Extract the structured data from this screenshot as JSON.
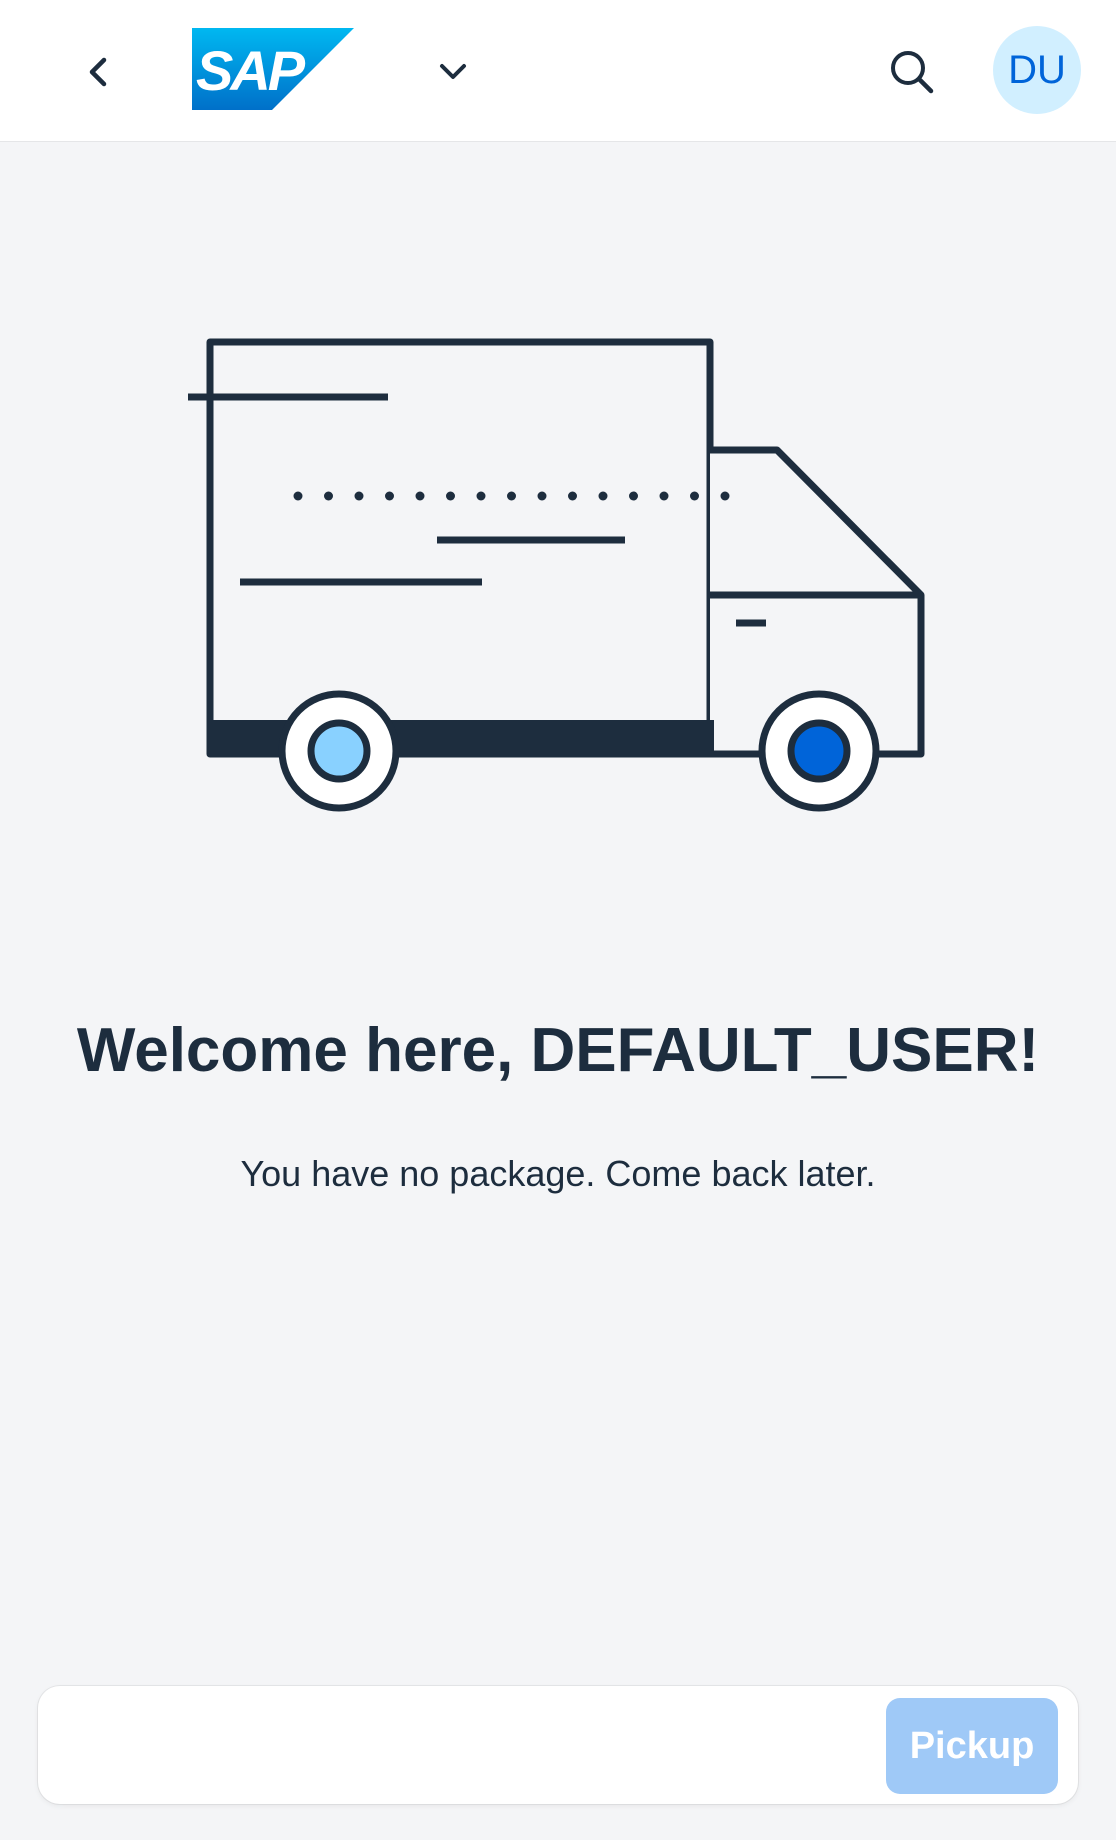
{
  "shellbar": {
    "back_icon": "chevron-left-icon",
    "logo_text": "SAP",
    "logo_menu_icon": "chevron-down-icon",
    "search_icon": "search-icon",
    "avatar_initials": "DU"
  },
  "main": {
    "illustration": "delivery-truck-icon",
    "title": "Welcome here, DEFAULT_USER!",
    "subtitle": "You have no package. Come back later."
  },
  "footer": {
    "pickup_label": "Pickup",
    "pickup_enabled": false
  },
  "colors": {
    "background": "#f4f5f7",
    "text": "#1d2d3e",
    "avatar_bg": "#d1efff",
    "avatar_text": "#0064d9",
    "button_disabled_bg": "#9fc9f7",
    "accent_blue": "#0064d9",
    "light_blue": "#89d1ff"
  }
}
